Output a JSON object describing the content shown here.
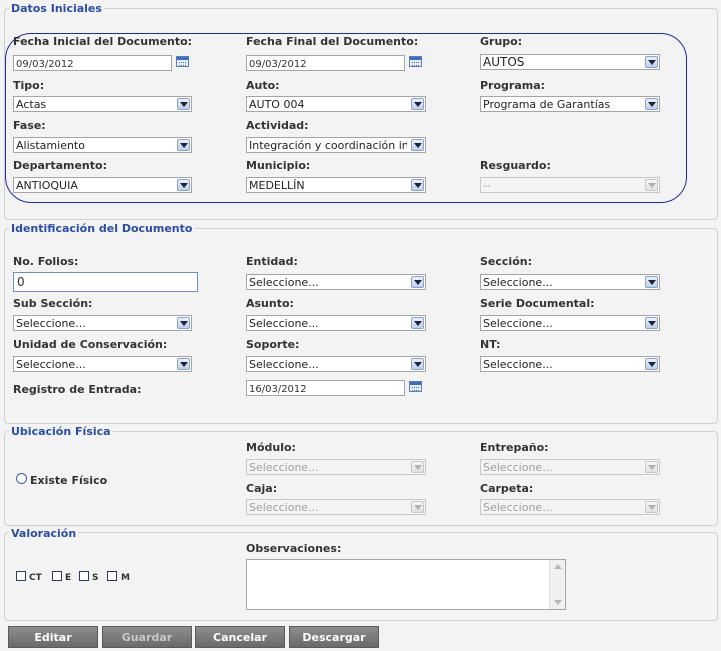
{
  "datos_iniciales": {
    "legend": "Datos Iniciales",
    "fecha_inicial_label": "Fecha Inicial del Documento:",
    "fecha_inicial_value": "09/03/2012",
    "fecha_final_label": "Fecha Final del Documento:",
    "fecha_final_value": "09/03/2012",
    "grupo_label": "Grupo:",
    "grupo_value": "AUTOS",
    "tipo_label": "Tipo:",
    "tipo_value": "Actas",
    "auto_label": "Auto:",
    "auto_value": "AUTO 004",
    "programa_label": "Programa:",
    "programa_value": "Programa de Garantías",
    "fase_label": "Fase:",
    "fase_value": "Alistamiento",
    "actividad_label": "Actividad:",
    "actividad_value": "Integración y coordinación inte",
    "departamento_label": "Departamento:",
    "departamento_value": "ANTIOQUIA",
    "municipio_label": "Municipio:",
    "municipio_value": "MEDELLÍN",
    "resguardo_label": "Resguardo:",
    "resguardo_value": "--"
  },
  "identificacion": {
    "legend": "Identificación del Documento",
    "folios_label": "No. Folios:",
    "folios_value": "0",
    "entidad_label": "Entidad:",
    "entidad_value": "Seleccione...",
    "seccion_label": "Sección:",
    "seccion_value": "Seleccione...",
    "subseccion_label": "Sub Sección:",
    "subseccion_value": "Seleccione...",
    "asunto_label": "Asunto:",
    "asunto_value": "Seleccione...",
    "serie_label": "Serie Documental:",
    "serie_value": "Seleccione...",
    "unidad_label": "Unidad de Conservación:",
    "unidad_value": "Seleccione...",
    "soporte_label": "Soporte:",
    "soporte_value": "Seleccione...",
    "nt_label": "NT:",
    "nt_value": "Seleccione...",
    "registro_label": "Registro de Entrada:",
    "registro_value": "16/03/2012"
  },
  "ubicacion": {
    "legend": "Ubicación Física",
    "existe_label": "Existe Físico",
    "modulo_label": "Módulo:",
    "modulo_value": "Seleccione...",
    "entrepano_label": "Entrepaño:",
    "entrepano_value": "Seleccione...",
    "caja_label": "Caja:",
    "caja_value": "Seleccione...",
    "carpeta_label": "Carpeta:",
    "carpeta_value": "Seleccione..."
  },
  "valoracion": {
    "legend": "Valoración",
    "ct_label": "CT",
    "e_label": "E",
    "s_label": "S",
    "m_label": "M",
    "observaciones_label": "Observaciones:",
    "observaciones_value": ""
  },
  "buttons": {
    "editar": "Editar",
    "guardar": "Guardar",
    "cancelar": "Cancelar",
    "descargar": "Descargar"
  }
}
